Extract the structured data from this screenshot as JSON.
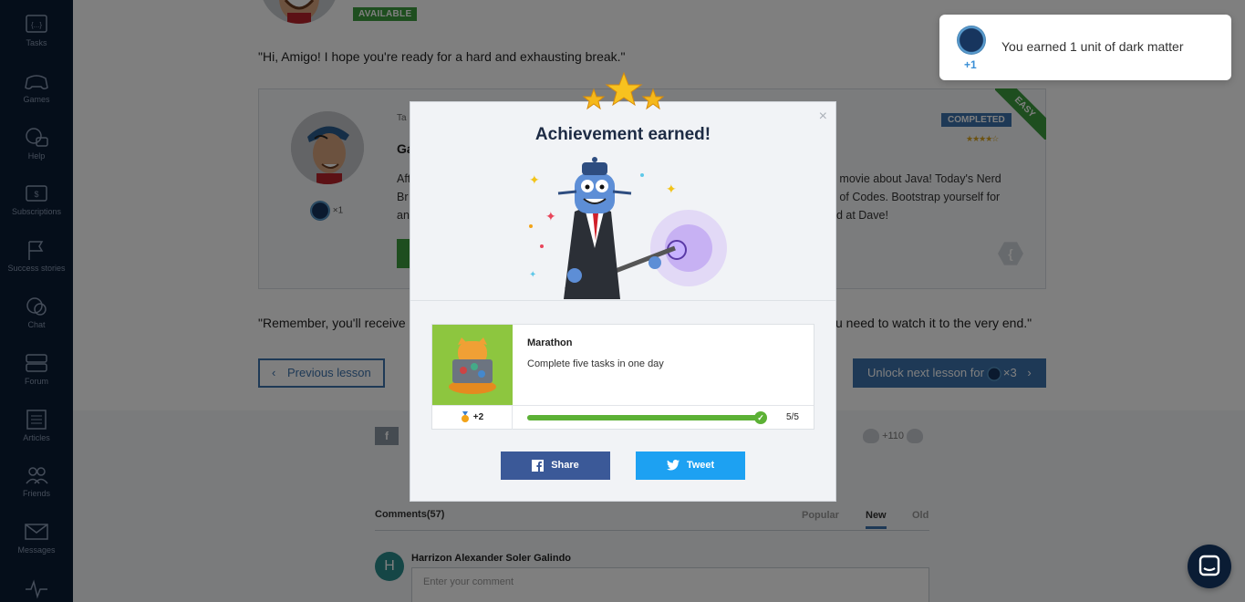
{
  "sidebar": {
    "items": [
      {
        "label": "Tasks",
        "icon": "tasks-icon"
      },
      {
        "label": "Games",
        "icon": "gamepad-icon"
      },
      {
        "label": "Help",
        "icon": "help-bubbles-icon"
      },
      {
        "label": "Subscriptions",
        "icon": "subscription-icon"
      },
      {
        "label": "Success stories",
        "icon": "flag-icon"
      },
      {
        "label": "Chat",
        "icon": "chat-bubbles-icon"
      },
      {
        "label": "Forum",
        "icon": "forum-icon"
      },
      {
        "label": "Articles",
        "icon": "articles-icon"
      },
      {
        "label": "Friends",
        "icon": "friends-icon"
      },
      {
        "label": "Messages",
        "icon": "envelope-icon"
      },
      {
        "label": "",
        "icon": "activity-icon"
      }
    ]
  },
  "lesson": {
    "available_badge": "AVAILABLE",
    "quote_intro": "\"Hi, Amigo! I hope you're ready for a hard and exhausting break.\"",
    "task_card": {
      "type_prefix": "Ta",
      "title_prefix": "Ga",
      "desc_left": [
        "Aft",
        "Br",
        "an"
      ],
      "desc_right": [
        "a movie about Java! Today's Nerd",
        "e of Codes. Bootstrap yourself for",
        "od at Dave!"
      ],
      "reward": "×1",
      "status_badge": "COMPLETED",
      "difficulty": "EASY",
      "rating_stars": "★★★★☆"
    },
    "quote_end_left": "\"Remember, you'll receive",
    "quote_end_right": "u need to watch it to the very end.\"",
    "prev_button": "Previous lesson",
    "next_button_prefix": "Unlock next lesson for",
    "next_button_cost": "×3",
    "likes_count": "+110"
  },
  "comments": {
    "title": "Comments(57)",
    "tabs": [
      {
        "label": "Popular",
        "active": false
      },
      {
        "label": "New",
        "active": true
      },
      {
        "label": "Old",
        "active": false
      }
    ],
    "commenter_initial": "H",
    "commenter_name": "Harrizon Alexander Soler Galindo",
    "input_placeholder": "Enter your comment"
  },
  "modal": {
    "title": "Achievement earned!",
    "close_glyph": "×",
    "achievement": {
      "name": "Marathon",
      "description": "Complete five tasks in one day",
      "reward": "+2",
      "progress_text": "5/5",
      "progress_fraction": 1.0
    },
    "share_label": "Share",
    "tweet_label": "Tweet"
  },
  "toast": {
    "plus": "+1",
    "message": "You earned 1 unit of dark matter"
  },
  "colors": {
    "sidebar_bg": "#0a1c34",
    "accent_blue": "#3d73ad",
    "success_green": "#3c9d3f",
    "facebook": "#3b5998",
    "twitter": "#1da1f2",
    "progress_green": "#5cb135"
  }
}
